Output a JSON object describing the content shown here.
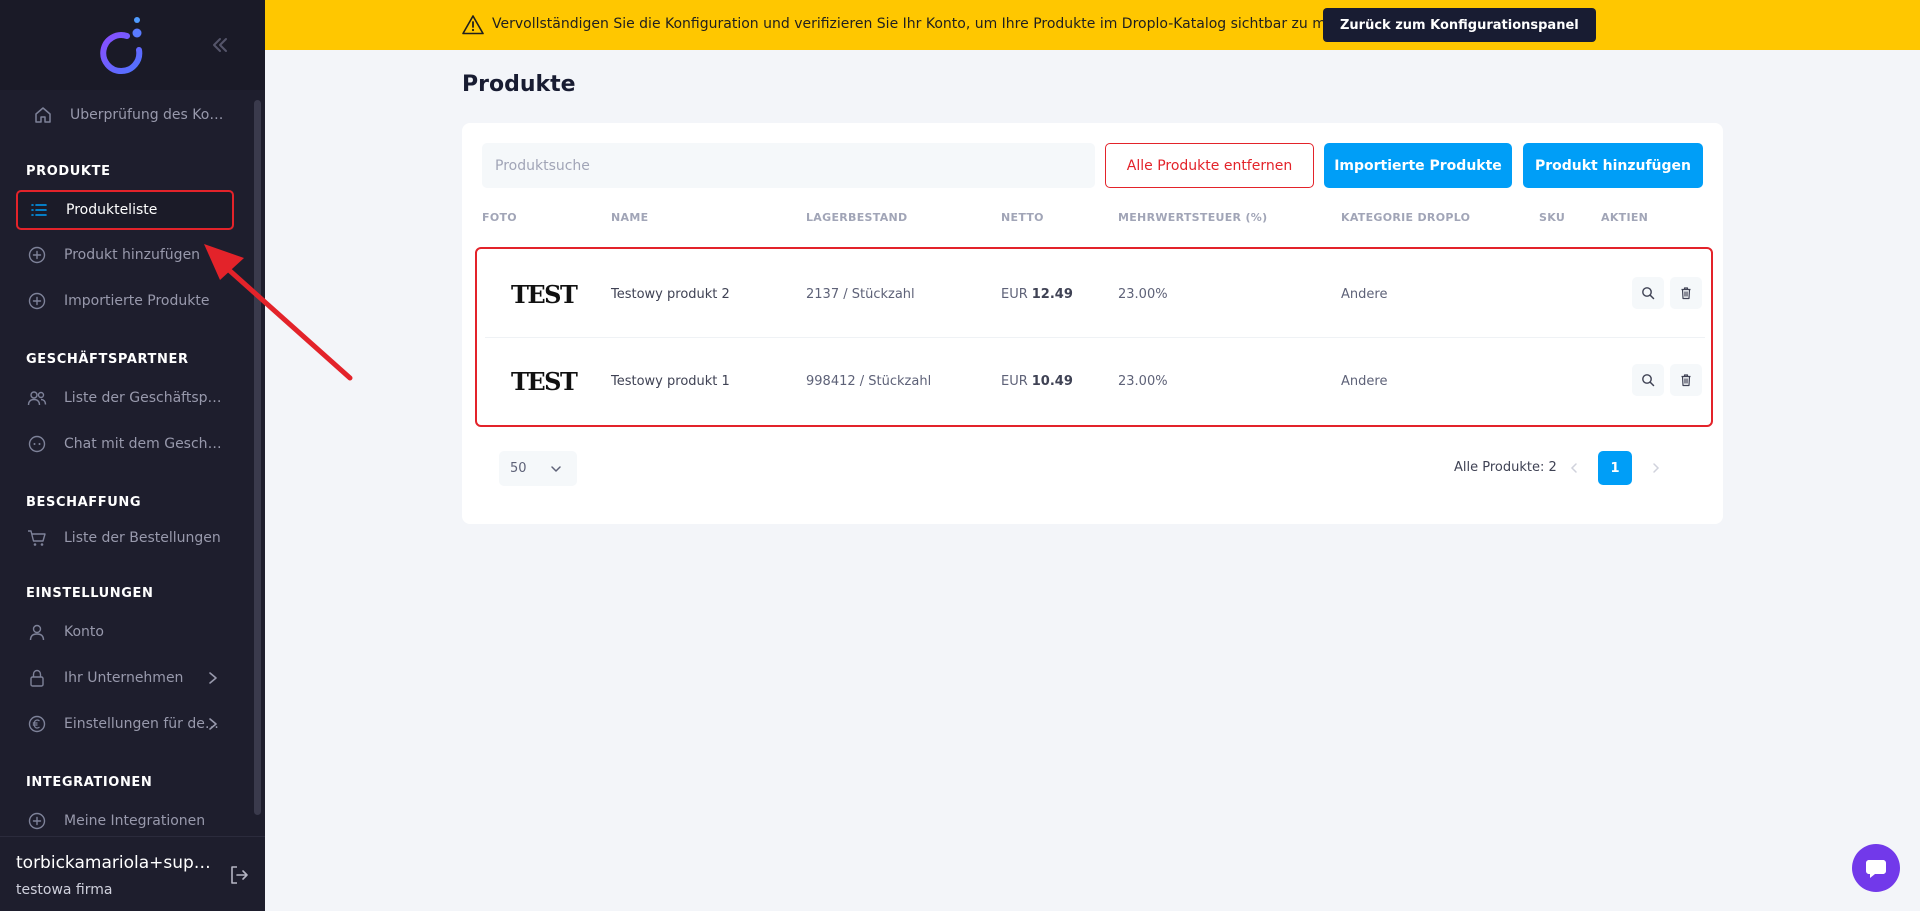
{
  "sidebar": {
    "account_review": "Überprüfung des Kontos",
    "sections": {
      "products": "PRODUKTE",
      "partners": "GESCHÄFTSPARTNER",
      "procurement": "BESCHAFFUNG",
      "settings": "EINSTELLUNGEN",
      "integrations": "INTEGRATIONEN"
    },
    "items": {
      "product_list": "Produkteliste",
      "add_product": "Produkt hinzufügen",
      "imported_products": "Importierte Produkte",
      "partner_list": "Liste der Geschäftspartner",
      "partner_chat": "Chat mit dem Geschäftspartner",
      "order_list": "Liste der Bestellungen",
      "account": "Konto",
      "company": "Ihr Unternehmen",
      "settings_for": "Einstellungen für den Versand",
      "my_integrations": "Meine Integrationen"
    },
    "user": {
      "name": "torbickamariola+supplier",
      "company": "testowa firma"
    }
  },
  "banner": {
    "text": "Vervollständigen Sie die Konfiguration und verifizieren Sie Ihr Konto, um Ihre Produkte im Droplo-Katalog sichtbar zu machen.",
    "button": "Zurück zum Konfigurationspanel"
  },
  "page": {
    "title": "Produkte",
    "search_placeholder": "Produktsuche",
    "buttons": {
      "remove_all": "Alle Produkte entfernen",
      "imported": "Importierte Produkte",
      "add": "Produkt hinzufügen"
    },
    "columns": [
      "FOTO",
      "NAME",
      "LAGERBESTAND",
      "NETTO",
      "MEHRWERTSTEUER (%)",
      "KATEGORIE DROPLO",
      "SKU",
      "AKTIEN"
    ],
    "products": [
      {
        "photo_text": "TEST",
        "name": "Testowy produkt 2",
        "stock": "2137 / Stückzahl",
        "currency": "EUR",
        "net": "12.49",
        "vat": "23.00%",
        "category": "Andere",
        "sku": ""
      },
      {
        "photo_text": "TEST",
        "name": "Testowy produkt 1",
        "stock": "998412 / Stückzahl",
        "currency": "EUR",
        "net": "10.49",
        "vat": "23.00%",
        "category": "Andere",
        "sku": ""
      }
    ],
    "page_size": "50",
    "total": "Alle Produkte: 2",
    "current_page": "1"
  },
  "colors": {
    "banner": "#ffc700",
    "primary": "#009ef7",
    "danger": "#e3232a",
    "sidebar": "#1e1e2d",
    "chat": "#7239ea"
  },
  "icons": {
    "home": "home-icon",
    "list": "list-icon",
    "plus_circle": "plus-circle-icon",
    "users": "users-icon",
    "chat": "chat-bubble-icon",
    "cart": "cart-icon",
    "user": "user-icon",
    "lock": "lock-icon",
    "euro": "euro-icon",
    "warning": "warning-icon",
    "search": "search-icon",
    "trash": "trash-icon",
    "logout": "logout-icon"
  }
}
